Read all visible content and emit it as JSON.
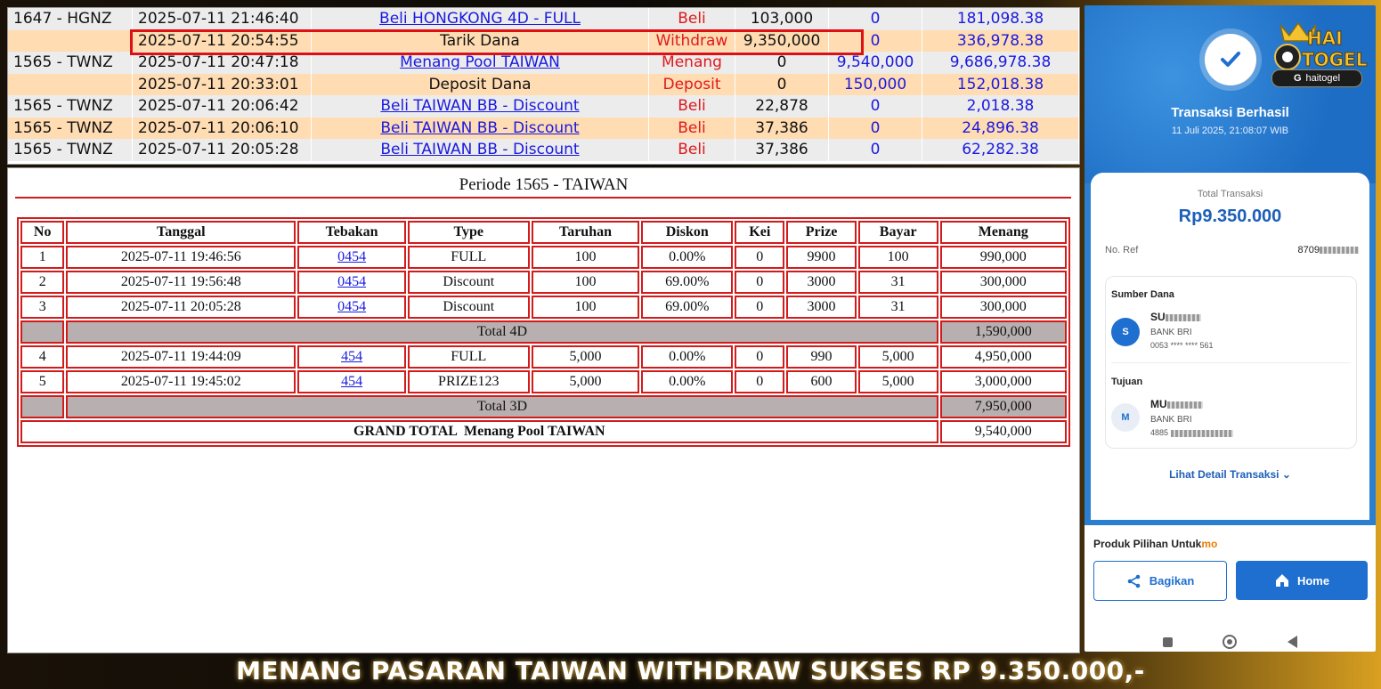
{
  "history": {
    "rows": [
      {
        "id": "1647 - HGNZ",
        "date": "2025-07-11 21:46:40",
        "desc": "Beli HONGKONG 4D - FULL",
        "link": true,
        "type": "Beli",
        "amount": "103,000",
        "win": "0",
        "balance": "181,098.38"
      },
      {
        "id": "",
        "date": "2025-07-11 20:54:55",
        "desc": "Tarik Dana",
        "link": false,
        "type": "Withdraw",
        "amount": "9,350,000",
        "win": "0",
        "balance": "336,978.38"
      },
      {
        "id": "1565 - TWNZ",
        "date": "2025-07-11 20:47:18",
        "desc": "Menang Pool TAIWAN",
        "link": true,
        "type": "Menang",
        "amount": "0",
        "win": "9,540,000",
        "balance": "9,686,978.38"
      },
      {
        "id": "",
        "date": "2025-07-11 20:33:01",
        "desc": "Deposit Dana",
        "link": false,
        "type": "Deposit",
        "amount": "0",
        "win": "150,000",
        "balance": "152,018.38"
      },
      {
        "id": "1565 - TWNZ",
        "date": "2025-07-11 20:06:42",
        "desc": "Beli TAIWAN BB - Discount",
        "link": true,
        "type": "Beli",
        "amount": "22,878",
        "win": "0",
        "balance": "2,018.38"
      },
      {
        "id": "1565 - TWNZ",
        "date": "2025-07-11 20:06:10",
        "desc": "Beli TAIWAN BB - Discount",
        "link": true,
        "type": "Beli",
        "amount": "37,386",
        "win": "0",
        "balance": "24,896.38"
      },
      {
        "id": "1565 - TWNZ",
        "date": "2025-07-11 20:05:28",
        "desc": "Beli TAIWAN BB - Discount",
        "link": true,
        "type": "Beli",
        "amount": "37,386",
        "win": "0",
        "balance": "62,282.38"
      }
    ]
  },
  "periode": {
    "title": "Periode 1565 - TAIWAN",
    "headers": [
      "No",
      "Tanggal",
      "Tebakan",
      "Type",
      "Taruhan",
      "Diskon",
      "Kei",
      "Prize",
      "Bayar",
      "Menang"
    ],
    "rows_4d": [
      [
        "1",
        "2025-07-11 19:46:56",
        "0454",
        "FULL",
        "100",
        "0.00%",
        "0",
        "9900",
        "100",
        "990,000"
      ],
      [
        "2",
        "2025-07-11 19:56:48",
        "0454",
        "Discount",
        "100",
        "69.00%",
        "0",
        "3000",
        "31",
        "300,000"
      ],
      [
        "3",
        "2025-07-11 20:05:28",
        "0454",
        "Discount",
        "100",
        "69.00%",
        "0",
        "3000",
        "31",
        "300,000"
      ]
    ],
    "total_4d_label": "Total 4D",
    "total_4d_value": "1,590,000",
    "rows_3d": [
      [
        "4",
        "2025-07-11 19:44:09",
        "454",
        "FULL",
        "5,000",
        "0.00%",
        "0",
        "990",
        "5,000",
        "4,950,000"
      ],
      [
        "5",
        "2025-07-11 19:45:02",
        "454",
        "PRIZE123",
        "5,000",
        "0.00%",
        "0",
        "600",
        "5,000",
        "3,000,000"
      ]
    ],
    "total_3d_label": "Total 3D",
    "total_3d_value": "7,950,000",
    "grand_label": "GRAND TOTAL  Menang Pool TAIWAN",
    "grand_value": "9,540,000"
  },
  "receipt": {
    "logo_text": "HAI TOGEL",
    "logo_badge": "haitogel",
    "title": "Transaksi Berhasil",
    "date": "11 Juli 2025, 21:08:07 WIB",
    "total_label": "Total Transaksi",
    "amount": "Rp9.350.000",
    "ref_label": "No. Ref",
    "ref_value": "8709",
    "source_label": "Sumber Dana",
    "source_initial": "S",
    "source_name": "SU",
    "source_bank": "BANK BRI",
    "source_account": "0053 **** **** 561",
    "dest_label": "Tujuan",
    "dest_initial": "M",
    "dest_name": "MU",
    "dest_bank": "BANK BRI",
    "dest_account": "4885",
    "detail_link": "Lihat Detail Transaksi",
    "products_label": "Produk Pilihan Untuk",
    "products_brand": "mo",
    "share_label": "Bagikan",
    "home_label": "Home"
  },
  "caption": "MENANG PASARAN TAIWAN WITHDRAW SUKSES RP 9.350.000,-",
  "colors": {
    "accent_red": "#d21b1b",
    "link_blue": "#1a1ae0",
    "bri_blue": "#1e6fd0",
    "gold": "#d9a021"
  }
}
